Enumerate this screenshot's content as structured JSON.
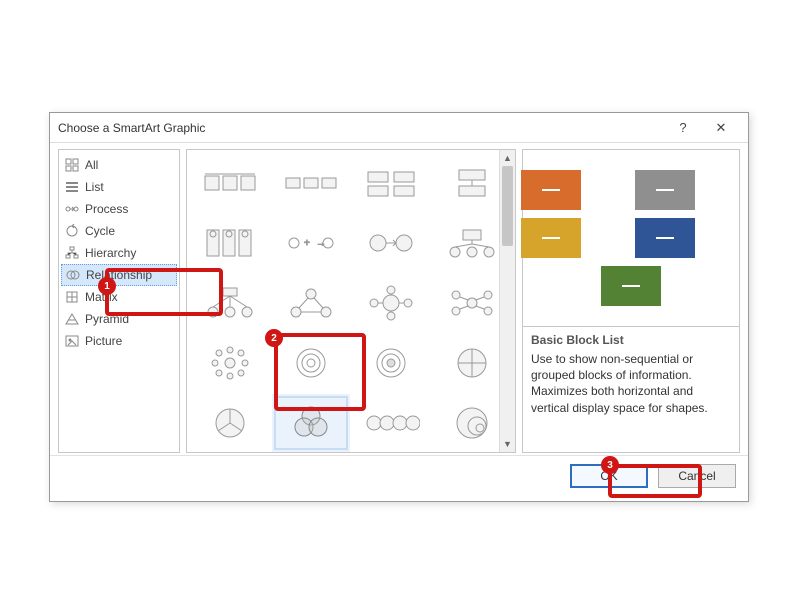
{
  "dialog": {
    "title": "Choose a SmartArt Graphic",
    "help_symbol": "?",
    "close_symbol": "✕"
  },
  "categories": [
    {
      "label": "All"
    },
    {
      "label": "List"
    },
    {
      "label": "Process"
    },
    {
      "label": "Cycle"
    },
    {
      "label": "Hierarchy"
    },
    {
      "label": "Relationship",
      "selected": true
    },
    {
      "label": "Matrix"
    },
    {
      "label": "Pyramid"
    },
    {
      "label": "Picture"
    }
  ],
  "preview": {
    "title": "Basic Block List",
    "body": "Use to show non-sequential or grouped blocks of information. Maximizes both horizontal and vertical display space for shapes.",
    "blocks": [
      {
        "color": "orange"
      },
      {
        "color": "gray"
      },
      {
        "color": "yellow"
      },
      {
        "color": "blue"
      },
      {
        "color": "green"
      }
    ]
  },
  "buttons": {
    "ok": "OK",
    "cancel": "Cancel"
  },
  "annotations": {
    "n1": "1",
    "n2": "2",
    "n3": "3"
  }
}
